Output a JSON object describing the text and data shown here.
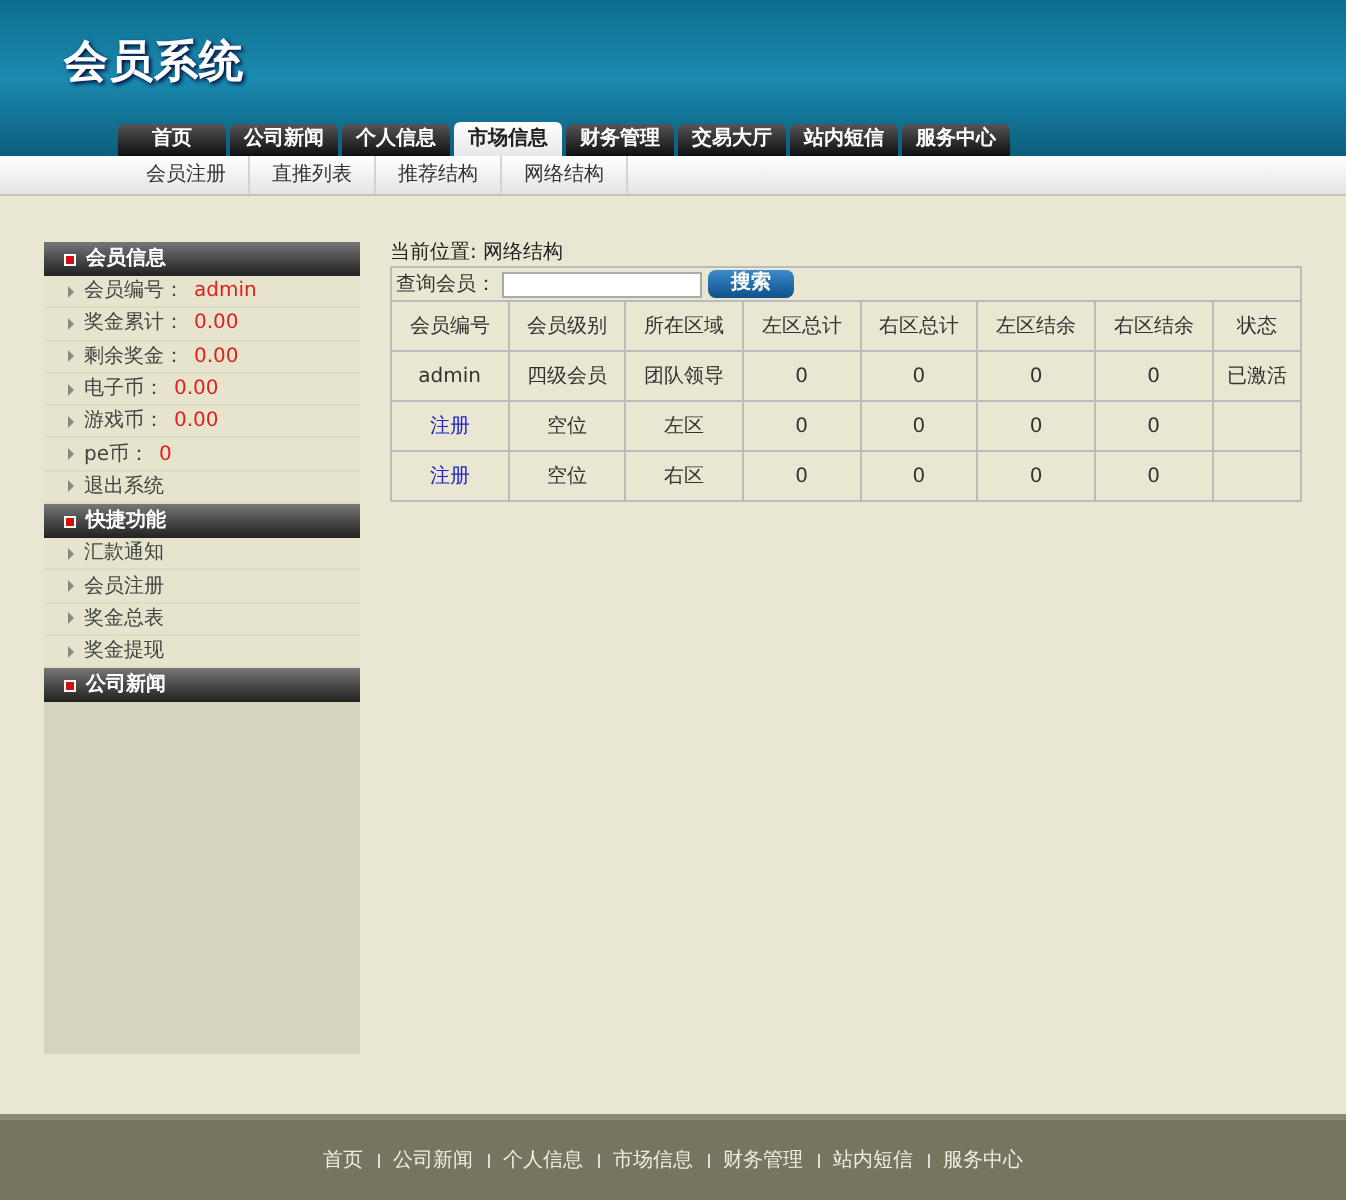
{
  "header": {
    "logo": "会员系统"
  },
  "nav_tabs": [
    {
      "label": "首页",
      "selected": false
    },
    {
      "label": "公司新闻",
      "selected": false
    },
    {
      "label": "个人信息",
      "selected": false
    },
    {
      "label": "市场信息",
      "selected": true
    },
    {
      "label": "财务管理",
      "selected": false
    },
    {
      "label": "交易大厅",
      "selected": false
    },
    {
      "label": "站内短信",
      "selected": false
    },
    {
      "label": "服务中心",
      "selected": false
    }
  ],
  "sub_nav": [
    "会员注册",
    "直推列表",
    "推荐结构",
    "网络结构"
  ],
  "sidebar": [
    {
      "title": "会员信息",
      "items": [
        {
          "label": "会员编号：",
          "value": "admin"
        },
        {
          "label": "奖金累计：",
          "value": "0.00"
        },
        {
          "label": "剩余奖金：",
          "value": "0.00"
        },
        {
          "label": "电子币：",
          "value": "0.00"
        },
        {
          "label": "游戏币：",
          "value": "0.00"
        },
        {
          "label": "pe币：",
          "value": "0"
        },
        {
          "label": "退出系统"
        }
      ]
    },
    {
      "title": "快捷功能",
      "items": [
        {
          "label": "汇款通知"
        },
        {
          "label": "会员注册"
        },
        {
          "label": "奖金总表"
        },
        {
          "label": "奖金提现"
        }
      ]
    },
    {
      "title": "公司新闻"
    }
  ],
  "breadcrumb": "当前位置: 网络结构",
  "search": {
    "label": "查询会员：",
    "button": "搜索"
  },
  "table": {
    "columns": [
      "会员编号",
      "会员级别",
      "所在区域",
      "左区总计",
      "右区总计",
      "左区结余",
      "右区结余",
      "状态"
    ],
    "rows": [
      [
        {
          "text": "admin",
          "kind": "text"
        },
        {
          "text": "四级会员",
          "kind": "text"
        },
        {
          "text": "团队领导",
          "kind": "text"
        },
        {
          "text": "0",
          "kind": "text"
        },
        {
          "text": "0",
          "kind": "text"
        },
        {
          "text": "0",
          "kind": "text"
        },
        {
          "text": "0",
          "kind": "text"
        },
        {
          "text": "已激活",
          "kind": "text"
        }
      ],
      [
        {
          "text": "注册",
          "kind": "link"
        },
        {
          "text": "空位",
          "kind": "text"
        },
        {
          "text": "左区",
          "kind": "text"
        },
        {
          "text": "0",
          "kind": "text"
        },
        {
          "text": "0",
          "kind": "text"
        },
        {
          "text": "0",
          "kind": "text"
        },
        {
          "text": "0",
          "kind": "text"
        }
      ],
      [
        {
          "text": "注册",
          "kind": "link"
        },
        {
          "text": "空位",
          "kind": "text"
        },
        {
          "text": "右区",
          "kind": "text"
        },
        {
          "text": "0",
          "kind": "text"
        },
        {
          "text": "0",
          "kind": "text"
        },
        {
          "text": "0",
          "kind": "text"
        },
        {
          "text": "0",
          "kind": "text"
        }
      ]
    ]
  },
  "footer": [
    "首页",
    "公司新闻",
    "个人信息",
    "市场信息",
    "财务管理",
    "站内短信",
    "服务中心"
  ]
}
